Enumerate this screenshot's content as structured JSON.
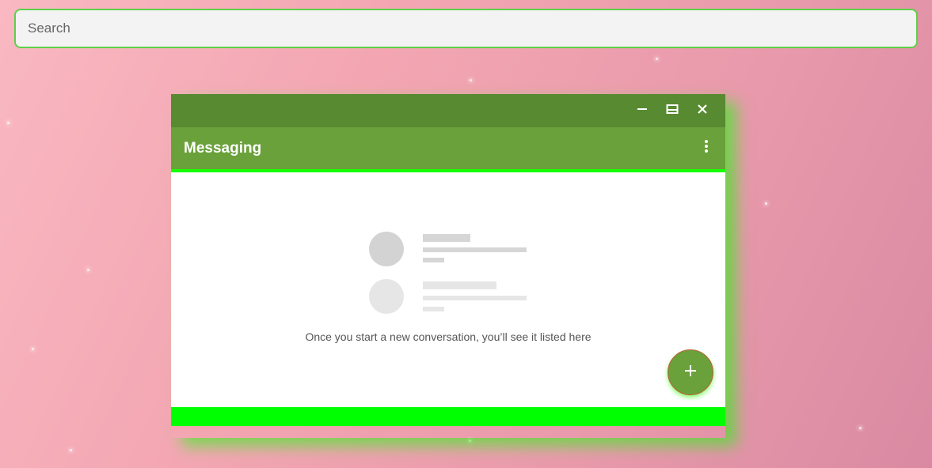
{
  "search": {
    "placeholder": "Search",
    "value": ""
  },
  "window": {
    "controls": [
      "minimize-icon",
      "maximize-icon",
      "close-icon"
    ],
    "app_title": "Messaging",
    "menu_icon": "more-vert-icon"
  },
  "empty_state": {
    "message": "Once you start a new conversation, you’ll see it listed here"
  },
  "fab": {
    "icon": "plus-icon"
  },
  "colors": {
    "titlebar": "#578a31",
    "appbar": "#6aa13a",
    "accent_glow": "#00ff00",
    "search_border": "#5ed04a"
  }
}
